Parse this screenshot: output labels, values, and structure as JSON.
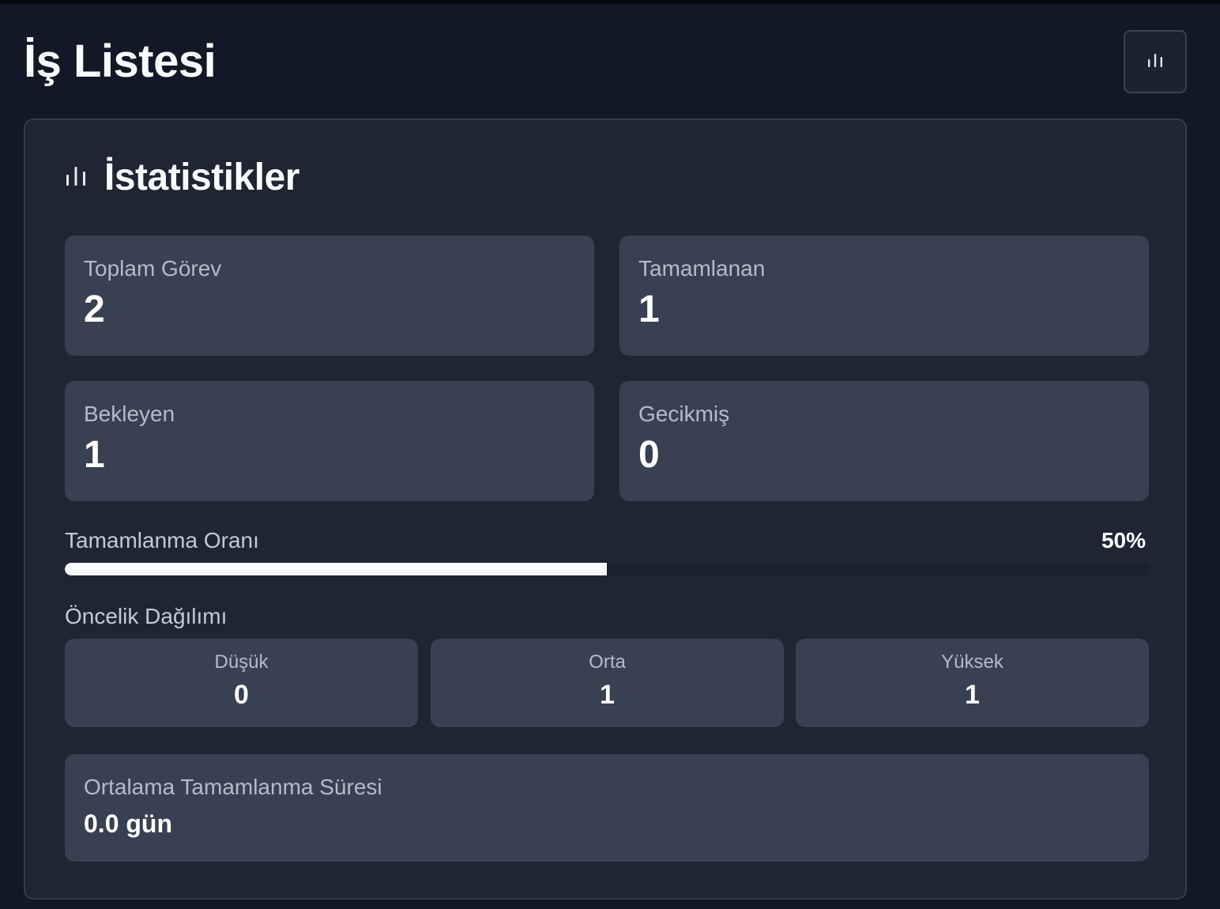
{
  "header": {
    "title": "İş Listesi",
    "toggle_icon": "bar-chart-icon"
  },
  "stats": {
    "title": "İstatistikler",
    "icon": "bar-chart-icon",
    "tiles": [
      {
        "label": "Toplam Görev",
        "value": "2"
      },
      {
        "label": "Tamamlanan",
        "value": "1"
      },
      {
        "label": "Bekleyen",
        "value": "1"
      },
      {
        "label": "Gecikmiş",
        "value": "0"
      }
    ],
    "completion": {
      "label": "Tamamlanma Oranı",
      "percent_text": "50%",
      "percent": 50
    },
    "priority": {
      "heading": "Öncelik Dağılımı",
      "items": [
        {
          "label": "Düşük",
          "value": "0"
        },
        {
          "label": "Orta",
          "value": "1"
        },
        {
          "label": "Yüksek",
          "value": "1"
        }
      ]
    },
    "average": {
      "label": "Ortalama Tamamlanma Süresi",
      "value": "0.0 gün"
    }
  },
  "colors": {
    "background": "#121826",
    "card": "#1f2533",
    "tile": "#384152",
    "progress_fill": "#f8fafc"
  }
}
